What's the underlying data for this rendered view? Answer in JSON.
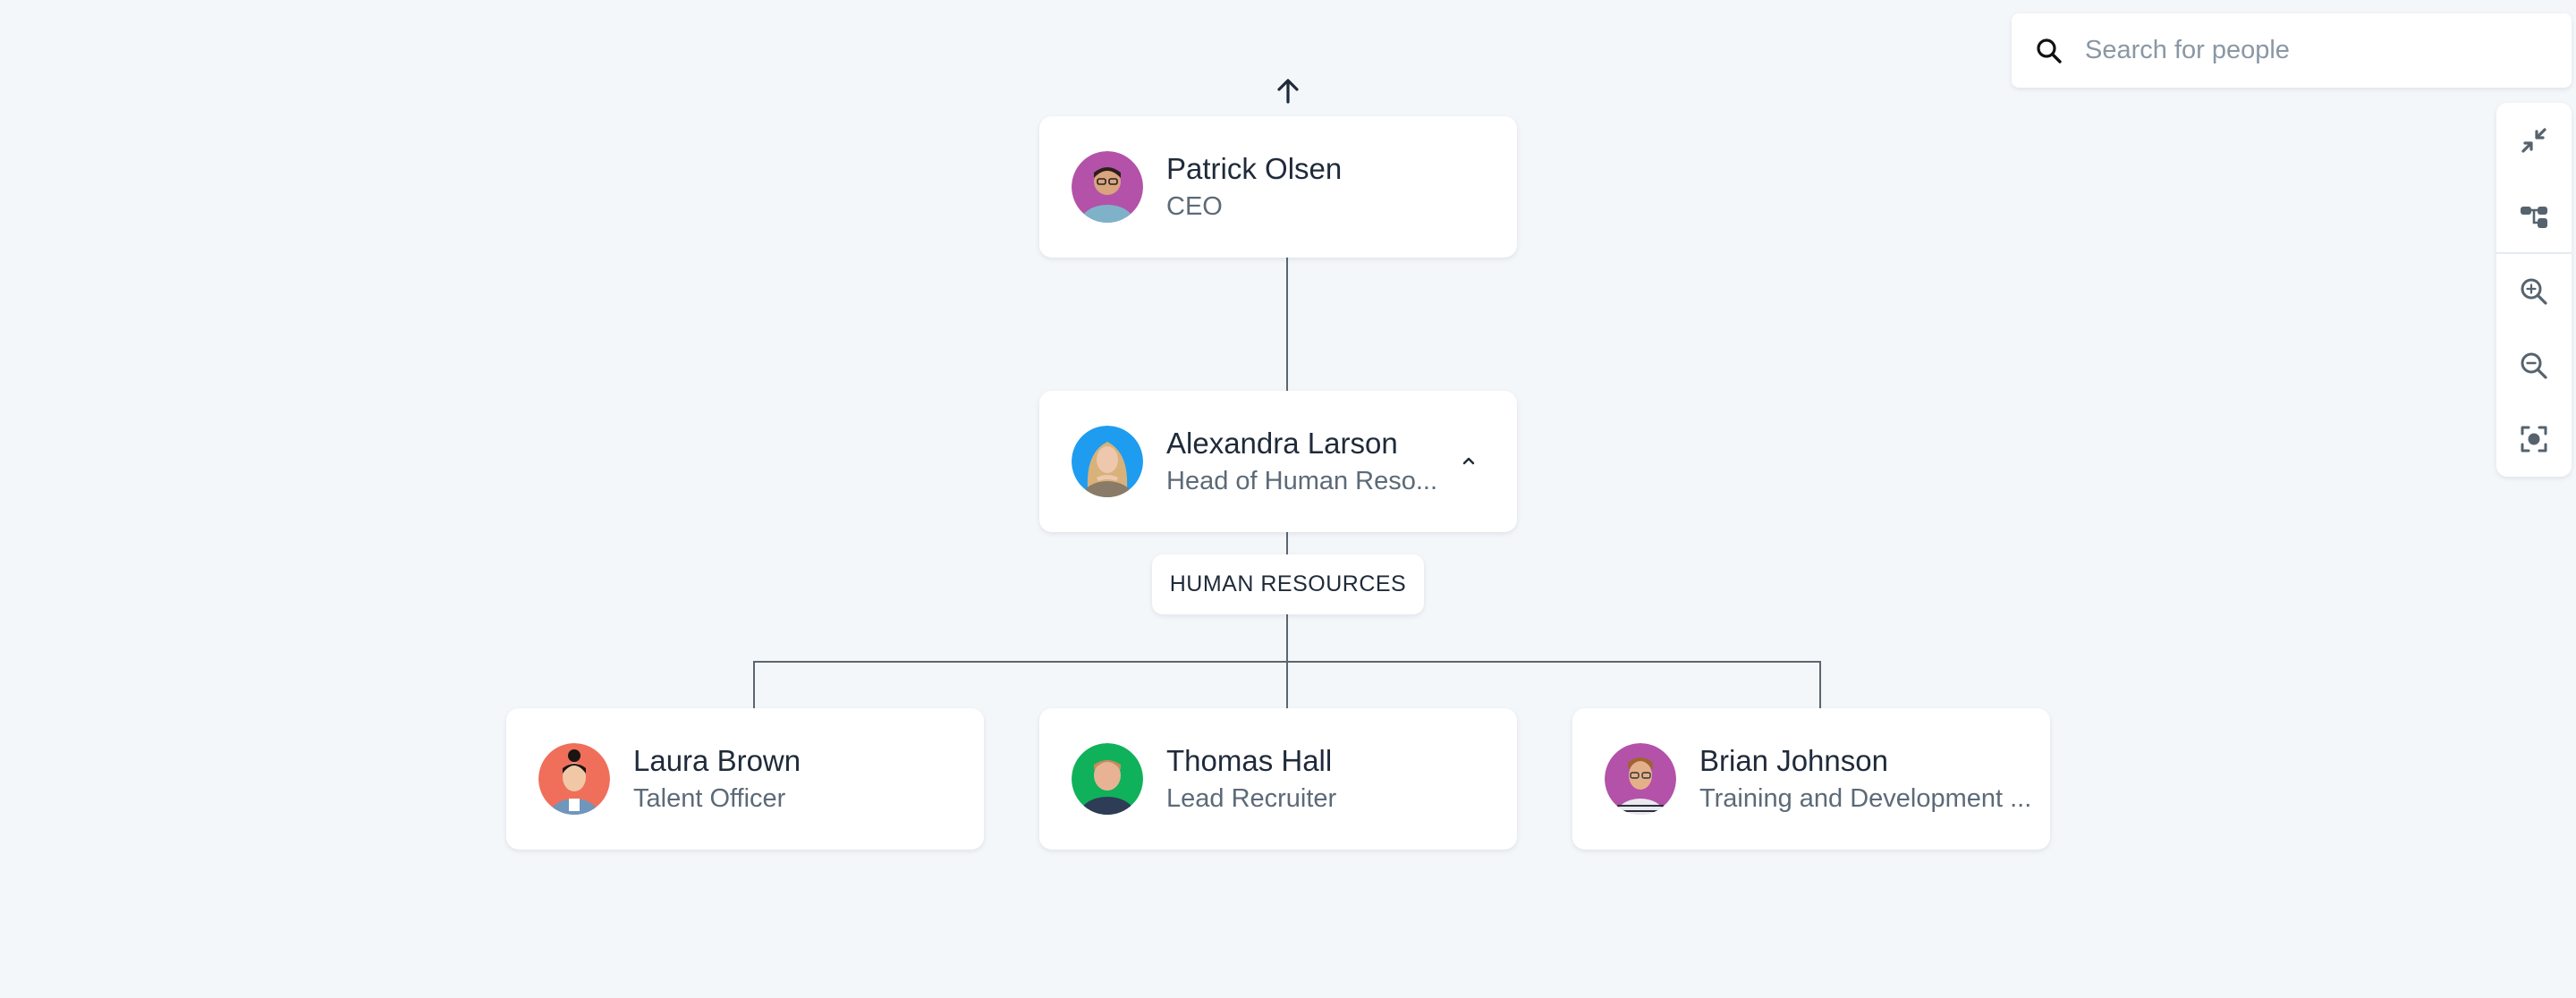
{
  "search": {
    "placeholder": "Search for people",
    "value": "",
    "icon": "search-icon"
  },
  "toolbar": {
    "buttons": [
      {
        "name": "collapse-all",
        "icon": "collapse-arrows-icon"
      },
      {
        "name": "org-layout",
        "icon": "org-tree-icon"
      },
      {
        "name": "zoom-in",
        "icon": "zoom-in-icon"
      },
      {
        "name": "zoom-out",
        "icon": "zoom-out-icon"
      },
      {
        "name": "center-view",
        "icon": "focus-center-icon"
      }
    ]
  },
  "navigate_up": {
    "icon": "arrow-up-icon"
  },
  "org": {
    "root": {
      "name": "Patrick Olsen",
      "title": "CEO",
      "avatar_color": "#b352a8"
    },
    "manager": {
      "name": "Alexandra Larson",
      "title": "Head of Human Reso...",
      "avatar_color": "#1e9cf0",
      "expanded": true,
      "toggle_icon": "chevron-up-icon"
    },
    "department": "HUMAN RESOURCES",
    "reports": [
      {
        "name": "Laura Brown",
        "title": "Talent Officer",
        "avatar_color": "#ef6f5b"
      },
      {
        "name": "Thomas Hall",
        "title": "Lead Recruiter",
        "avatar_color": "#0fb15a"
      },
      {
        "name": "Brian Johnson",
        "title": "Training and Development ...",
        "avatar_color": "#b352a8"
      }
    ]
  }
}
